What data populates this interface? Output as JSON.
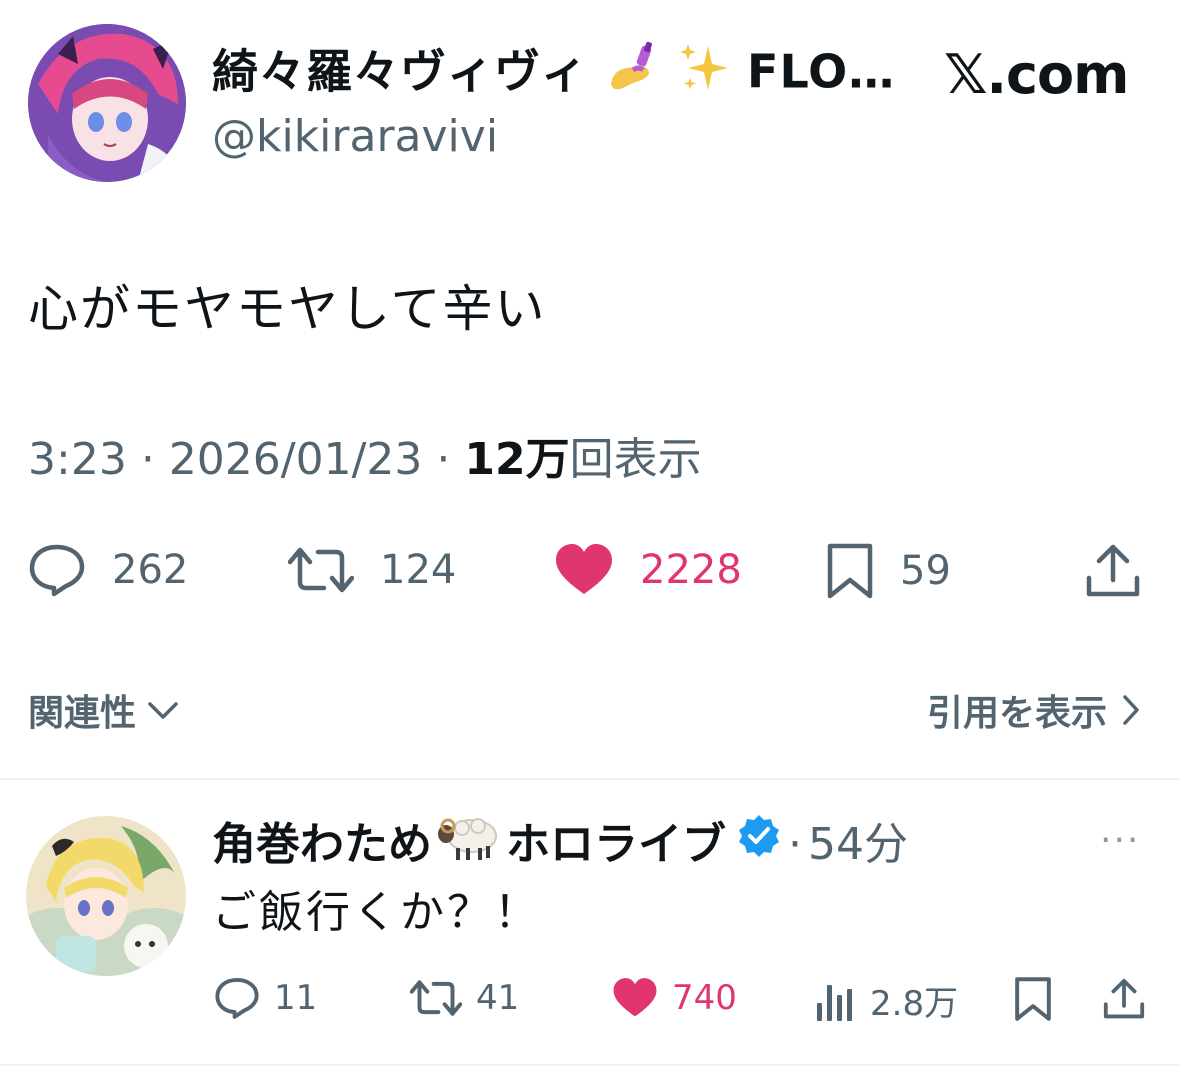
{
  "header": {
    "display_name": "綺々羅々ヴィヴィ",
    "display_name_suffix": "FLO…",
    "handle": "@kikiraravivi",
    "site": "𝕏.com"
  },
  "tweet": {
    "text": "心がモヤモヤして辛い",
    "time": "3:23",
    "separator": "·",
    "date": "2026/01/23",
    "views_number": "12万",
    "views_label": "回表示"
  },
  "actions": {
    "replies": "262",
    "retweets": "124",
    "likes": "2228",
    "bookmarks": "59"
  },
  "filters": {
    "relevance_label": "関連性",
    "quotes_label": "引用を表示"
  },
  "reply": {
    "display_name": "角巻わため",
    "display_name_suffix": "ホロライブ",
    "separator": "·",
    "time": "54分",
    "text": "ご飯行くか？！",
    "replies": "11",
    "retweets": "41",
    "likes": "740",
    "views": "2.8万",
    "more": "···"
  },
  "colors": {
    "text_primary": "#0f1419",
    "text_secondary": "#536471",
    "like_pink": "#e0356f",
    "verified_blue": "#1d9bf0",
    "divider": "#eff3f4"
  }
}
